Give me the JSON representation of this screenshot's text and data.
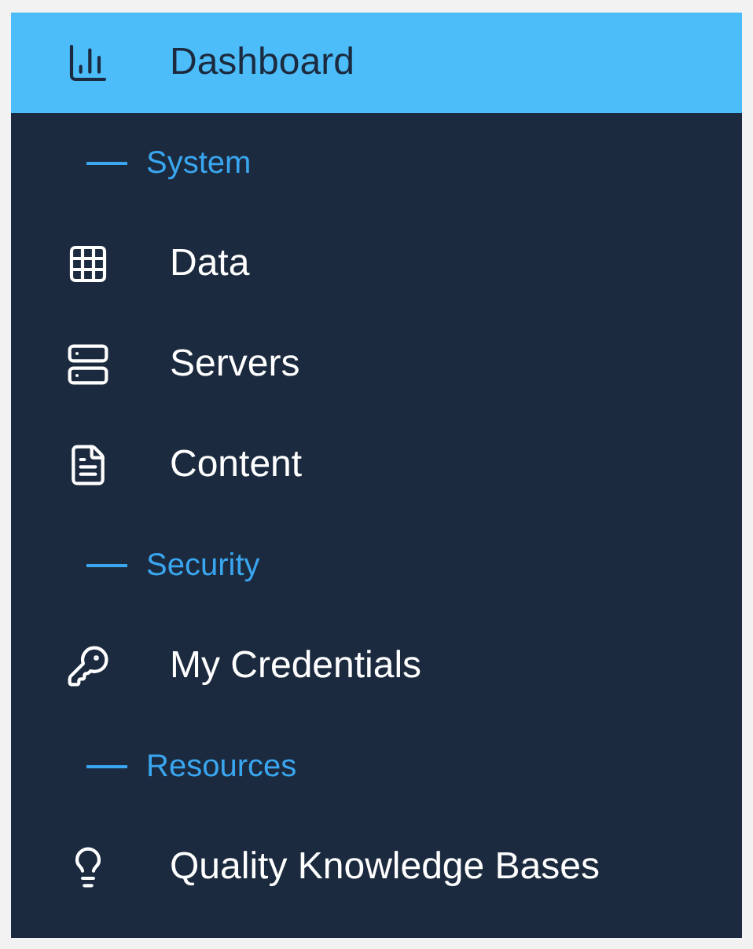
{
  "sidebar": {
    "items": [
      {
        "kind": "item",
        "label": "Dashboard",
        "selected": true
      },
      {
        "kind": "header",
        "label": "System"
      },
      {
        "kind": "item",
        "label": "Data",
        "selected": false
      },
      {
        "kind": "item",
        "label": "Servers",
        "selected": false
      },
      {
        "kind": "item",
        "label": "Content",
        "selected": false
      },
      {
        "kind": "header",
        "label": "Security"
      },
      {
        "kind": "item",
        "label": "My Credentials",
        "selected": false
      },
      {
        "kind": "header",
        "label": "Resources"
      },
      {
        "kind": "item",
        "label": "Quality Knowledge Bases",
        "selected": false
      }
    ]
  }
}
